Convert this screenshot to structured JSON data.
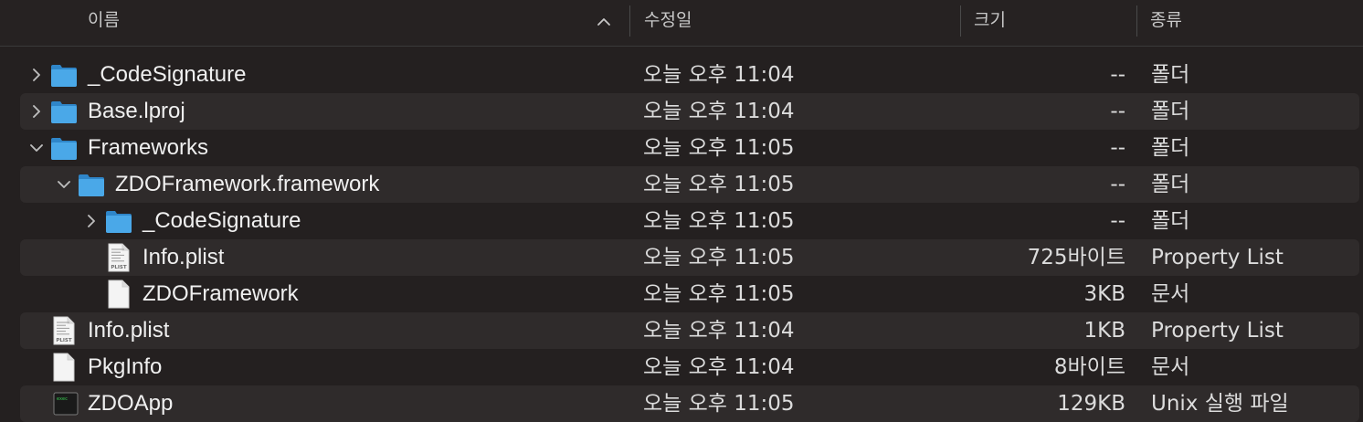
{
  "header": {
    "name_label": "이름",
    "date_label": "수정일",
    "size_label": "크기",
    "kind_label": "종류",
    "sort_icon": "chevron-up-icon"
  },
  "rows": [
    {
      "name": "_CodeSignature",
      "date": "오늘 오후 11:04",
      "size": "--",
      "kind": "폴더",
      "icon": "folder-icon",
      "disclosure": "chevron-right-icon",
      "depth": 0
    },
    {
      "name": "Base.lproj",
      "date": "오늘 오후 11:04",
      "size": "--",
      "kind": "폴더",
      "icon": "folder-icon",
      "disclosure": "chevron-right-icon",
      "depth": 0
    },
    {
      "name": "Frameworks",
      "date": "오늘 오후 11:05",
      "size": "--",
      "kind": "폴더",
      "icon": "folder-icon",
      "disclosure": "chevron-down-icon",
      "depth": 0
    },
    {
      "name": "ZDOFramework.framework",
      "date": "오늘 오후 11:05",
      "size": "--",
      "kind": "폴더",
      "icon": "folder-icon",
      "disclosure": "chevron-down-icon",
      "depth": 1
    },
    {
      "name": "_CodeSignature",
      "date": "오늘 오후 11:05",
      "size": "--",
      "kind": "폴더",
      "icon": "folder-icon",
      "disclosure": "chevron-right-icon",
      "depth": 2
    },
    {
      "name": "Info.plist",
      "date": "오늘 오후 11:05",
      "size": "725바이트",
      "kind": "Property List",
      "icon": "plist-file-icon",
      "icon_label": "PLIST",
      "depth": 2
    },
    {
      "name": "ZDOFramework",
      "date": "오늘 오후 11:05",
      "size": "3KB",
      "kind": "문서",
      "icon": "document-icon",
      "depth": 2
    },
    {
      "name": "Info.plist",
      "date": "오늘 오후 11:04",
      "size": "1KB",
      "kind": "Property List",
      "icon": "plist-file-icon",
      "icon_label": "PLIST",
      "depth": 0
    },
    {
      "name": "PkgInfo",
      "date": "오늘 오후 11:04",
      "size": "8바이트",
      "kind": "문서",
      "icon": "document-icon",
      "depth": 0
    },
    {
      "name": "ZDOApp",
      "date": "오늘 오후 11:05",
      "size": "129KB",
      "kind": "Unix 실행 파일",
      "icon": "terminal-exec-icon",
      "icon_label": "exec",
      "depth": 0
    }
  ],
  "colors": {
    "folder": "#4aa8e8",
    "background": "#242020",
    "stripe": "#2f2b2b"
  }
}
